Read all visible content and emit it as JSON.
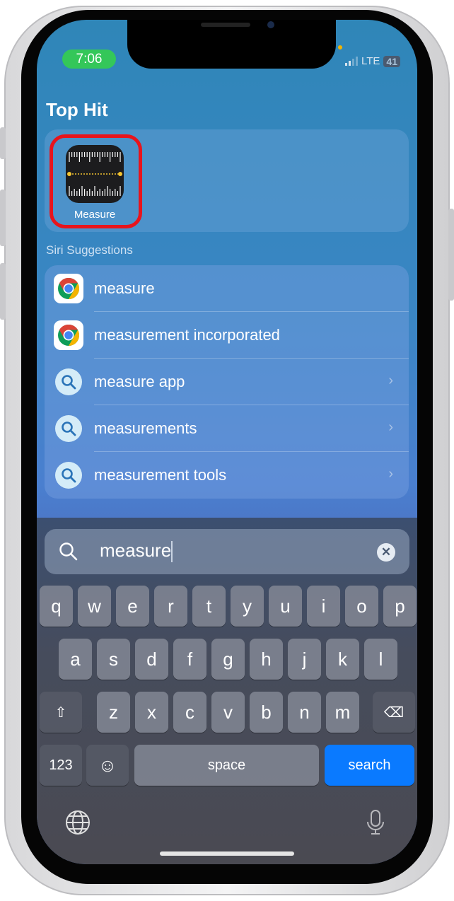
{
  "status_bar": {
    "time": "7:06",
    "network": "LTE",
    "battery": "41"
  },
  "top_hit": {
    "heading": "Top Hit",
    "app_label": "Measure",
    "highlight_color": "#e8141c"
  },
  "siri_suggestions": {
    "heading": "Siri Suggestions",
    "items": [
      {
        "label": "measure",
        "icon": "chrome-icon",
        "chevron": false
      },
      {
        "label": "measurement incorporated",
        "icon": "chrome-icon",
        "chevron": false
      },
      {
        "label": "measure app",
        "icon": "search-icon",
        "chevron": true
      },
      {
        "label": "measurements",
        "icon": "search-icon",
        "chevron": true
      },
      {
        "label": "measurement tools",
        "icon": "search-icon",
        "chevron": true
      }
    ]
  },
  "search": {
    "value": "measure",
    "clear_icon": "clear-icon"
  },
  "keyboard": {
    "row1": [
      "q",
      "w",
      "e",
      "r",
      "t",
      "y",
      "u",
      "i",
      "o",
      "p"
    ],
    "row2": [
      "a",
      "s",
      "d",
      "f",
      "g",
      "h",
      "j",
      "k",
      "l"
    ],
    "row3": [
      "z",
      "x",
      "c",
      "v",
      "b",
      "n",
      "m"
    ],
    "numbers": "123",
    "space": "space",
    "search": "search",
    "accent": "#0a7aff"
  }
}
